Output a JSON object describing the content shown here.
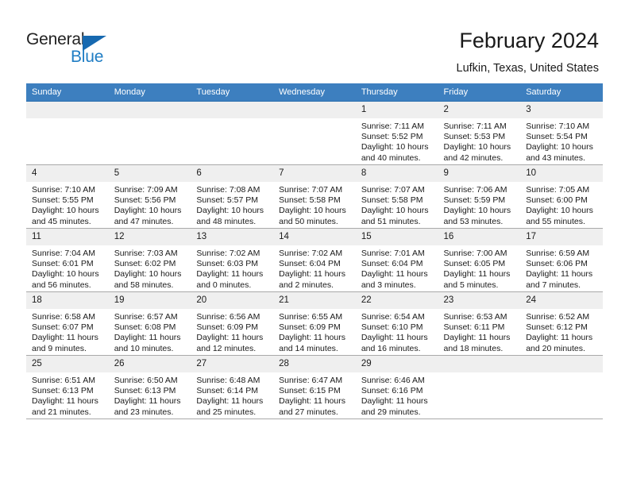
{
  "brand": {
    "name_primary": "General",
    "name_secondary": "Blue",
    "triangle_color": "#1769b0",
    "secondary_color": "#1f7dc4"
  },
  "header": {
    "title": "February 2024",
    "subtitle": "Lufkin, Texas, United States"
  },
  "theme": {
    "header_row_bg": "#3d7fbf",
    "daynum_bg": "#efefef",
    "grid_line": "#a9a9a9",
    "accent_line": "#2a6ead"
  },
  "weekday_headers": [
    "Sunday",
    "Monday",
    "Tuesday",
    "Wednesday",
    "Thursday",
    "Friday",
    "Saturday"
  ],
  "labels": {
    "sunrise": "Sunrise:",
    "sunset": "Sunset:",
    "daylight": "Daylight:"
  },
  "weeks": [
    [
      {
        "day": "",
        "empty": true
      },
      {
        "day": "",
        "empty": true
      },
      {
        "day": "",
        "empty": true
      },
      {
        "day": "",
        "empty": true
      },
      {
        "day": "1",
        "sunrise": "Sunrise: 7:11 AM",
        "sunset": "Sunset: 5:52 PM",
        "daylight": "Daylight: 10 hours and 40 minutes."
      },
      {
        "day": "2",
        "sunrise": "Sunrise: 7:11 AM",
        "sunset": "Sunset: 5:53 PM",
        "daylight": "Daylight: 10 hours and 42 minutes."
      },
      {
        "day": "3",
        "sunrise": "Sunrise: 7:10 AM",
        "sunset": "Sunset: 5:54 PM",
        "daylight": "Daylight: 10 hours and 43 minutes."
      }
    ],
    [
      {
        "day": "4",
        "sunrise": "Sunrise: 7:10 AM",
        "sunset": "Sunset: 5:55 PM",
        "daylight": "Daylight: 10 hours and 45 minutes."
      },
      {
        "day": "5",
        "sunrise": "Sunrise: 7:09 AM",
        "sunset": "Sunset: 5:56 PM",
        "daylight": "Daylight: 10 hours and 47 minutes."
      },
      {
        "day": "6",
        "sunrise": "Sunrise: 7:08 AM",
        "sunset": "Sunset: 5:57 PM",
        "daylight": "Daylight: 10 hours and 48 minutes."
      },
      {
        "day": "7",
        "sunrise": "Sunrise: 7:07 AM",
        "sunset": "Sunset: 5:58 PM",
        "daylight": "Daylight: 10 hours and 50 minutes."
      },
      {
        "day": "8",
        "sunrise": "Sunrise: 7:07 AM",
        "sunset": "Sunset: 5:58 PM",
        "daylight": "Daylight: 10 hours and 51 minutes."
      },
      {
        "day": "9",
        "sunrise": "Sunrise: 7:06 AM",
        "sunset": "Sunset: 5:59 PM",
        "daylight": "Daylight: 10 hours and 53 minutes."
      },
      {
        "day": "10",
        "sunrise": "Sunrise: 7:05 AM",
        "sunset": "Sunset: 6:00 PM",
        "daylight": "Daylight: 10 hours and 55 minutes."
      }
    ],
    [
      {
        "day": "11",
        "sunrise": "Sunrise: 7:04 AM",
        "sunset": "Sunset: 6:01 PM",
        "daylight": "Daylight: 10 hours and 56 minutes."
      },
      {
        "day": "12",
        "sunrise": "Sunrise: 7:03 AM",
        "sunset": "Sunset: 6:02 PM",
        "daylight": "Daylight: 10 hours and 58 minutes."
      },
      {
        "day": "13",
        "sunrise": "Sunrise: 7:02 AM",
        "sunset": "Sunset: 6:03 PM",
        "daylight": "Daylight: 11 hours and 0 minutes."
      },
      {
        "day": "14",
        "sunrise": "Sunrise: 7:02 AM",
        "sunset": "Sunset: 6:04 PM",
        "daylight": "Daylight: 11 hours and 2 minutes."
      },
      {
        "day": "15",
        "sunrise": "Sunrise: 7:01 AM",
        "sunset": "Sunset: 6:04 PM",
        "daylight": "Daylight: 11 hours and 3 minutes."
      },
      {
        "day": "16",
        "sunrise": "Sunrise: 7:00 AM",
        "sunset": "Sunset: 6:05 PM",
        "daylight": "Daylight: 11 hours and 5 minutes."
      },
      {
        "day": "17",
        "sunrise": "Sunrise: 6:59 AM",
        "sunset": "Sunset: 6:06 PM",
        "daylight": "Daylight: 11 hours and 7 minutes."
      }
    ],
    [
      {
        "day": "18",
        "sunrise": "Sunrise: 6:58 AM",
        "sunset": "Sunset: 6:07 PM",
        "daylight": "Daylight: 11 hours and 9 minutes."
      },
      {
        "day": "19",
        "sunrise": "Sunrise: 6:57 AM",
        "sunset": "Sunset: 6:08 PM",
        "daylight": "Daylight: 11 hours and 10 minutes."
      },
      {
        "day": "20",
        "sunrise": "Sunrise: 6:56 AM",
        "sunset": "Sunset: 6:09 PM",
        "daylight": "Daylight: 11 hours and 12 minutes."
      },
      {
        "day": "21",
        "sunrise": "Sunrise: 6:55 AM",
        "sunset": "Sunset: 6:09 PM",
        "daylight": "Daylight: 11 hours and 14 minutes."
      },
      {
        "day": "22",
        "sunrise": "Sunrise: 6:54 AM",
        "sunset": "Sunset: 6:10 PM",
        "daylight": "Daylight: 11 hours and 16 minutes."
      },
      {
        "day": "23",
        "sunrise": "Sunrise: 6:53 AM",
        "sunset": "Sunset: 6:11 PM",
        "daylight": "Daylight: 11 hours and 18 minutes."
      },
      {
        "day": "24",
        "sunrise": "Sunrise: 6:52 AM",
        "sunset": "Sunset: 6:12 PM",
        "daylight": "Daylight: 11 hours and 20 minutes."
      }
    ],
    [
      {
        "day": "25",
        "sunrise": "Sunrise: 6:51 AM",
        "sunset": "Sunset: 6:13 PM",
        "daylight": "Daylight: 11 hours and 21 minutes."
      },
      {
        "day": "26",
        "sunrise": "Sunrise: 6:50 AM",
        "sunset": "Sunset: 6:13 PM",
        "daylight": "Daylight: 11 hours and 23 minutes."
      },
      {
        "day": "27",
        "sunrise": "Sunrise: 6:48 AM",
        "sunset": "Sunset: 6:14 PM",
        "daylight": "Daylight: 11 hours and 25 minutes."
      },
      {
        "day": "28",
        "sunrise": "Sunrise: 6:47 AM",
        "sunset": "Sunset: 6:15 PM",
        "daylight": "Daylight: 11 hours and 27 minutes."
      },
      {
        "day": "29",
        "sunrise": "Sunrise: 6:46 AM",
        "sunset": "Sunset: 6:16 PM",
        "daylight": "Daylight: 11 hours and 29 minutes."
      },
      {
        "day": "",
        "empty": true
      },
      {
        "day": "",
        "empty": true
      }
    ]
  ]
}
